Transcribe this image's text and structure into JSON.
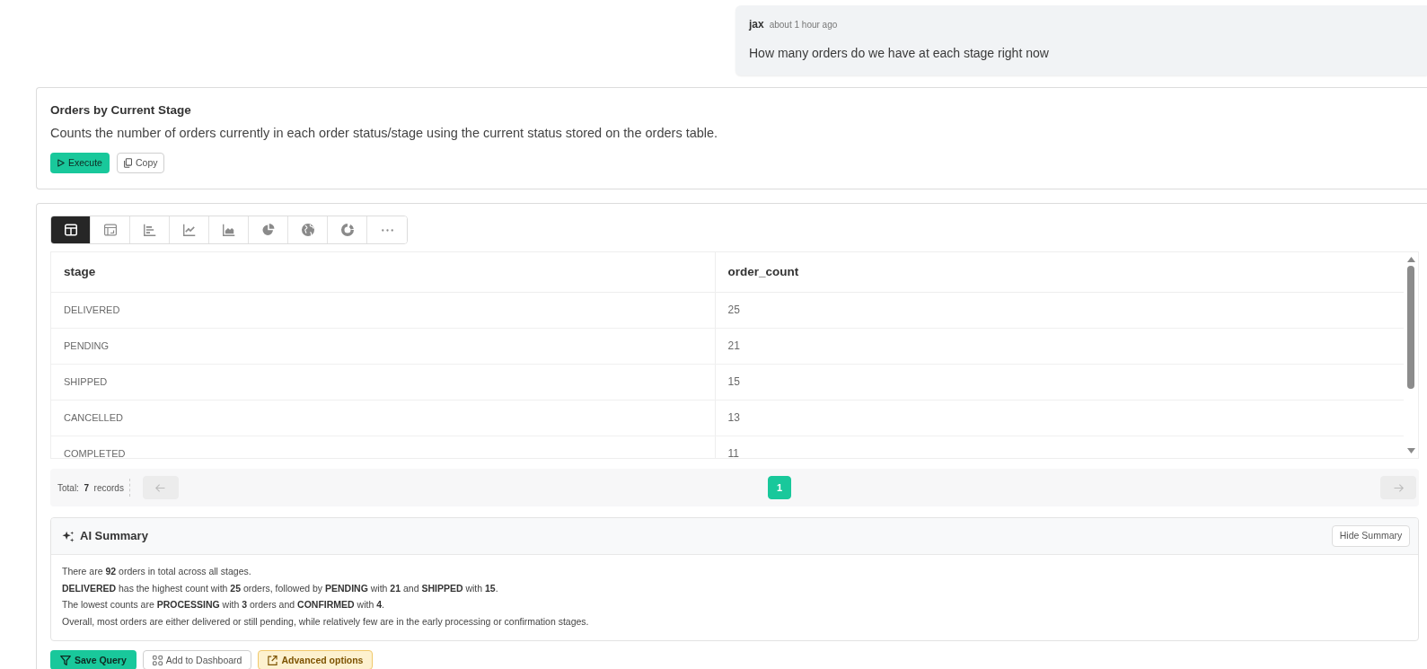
{
  "message": {
    "author": "jax",
    "time": "about 1 hour ago",
    "text": "How many orders do we have at each stage right now"
  },
  "query": {
    "title": "Orders by Current Stage",
    "description": "Counts the number of orders currently in each order status/stage using the current status stored on the orders table.",
    "buttons": [
      {
        "kind": "run",
        "label": "Execute"
      },
      {
        "kind": "copy",
        "label": "Copy"
      }
    ]
  },
  "view_toolbar": [
    {
      "kind": "table",
      "selected": true
    },
    {
      "kind": "pivot",
      "selected": false
    },
    {
      "kind": "bar",
      "selected": false
    },
    {
      "kind": "line",
      "selected": false
    },
    {
      "kind": "area",
      "selected": false
    },
    {
      "kind": "pie",
      "selected": false
    },
    {
      "kind": "map",
      "selected": false
    },
    {
      "kind": "donut",
      "selected": false
    },
    {
      "kind": "more",
      "selected": false
    }
  ],
  "table": {
    "columns": [
      "stage",
      "order_count"
    ],
    "rows": [
      [
        "DELIVERED",
        "25"
      ],
      [
        "PENDING",
        "21"
      ],
      [
        "SHIPPED",
        "15"
      ],
      [
        "CANCELLED",
        "13"
      ],
      [
        "COMPLETED",
        "11"
      ]
    ]
  },
  "pagination": {
    "total": "Total:  **7**  records",
    "prev_disabled": true,
    "next_disabled": true,
    "pages": [
      {
        "label": "1",
        "selected": true
      }
    ]
  },
  "summary": {
    "title": "AI Summary",
    "hide_button": "Hide Summary",
    "lines": [
      "There are **92** orders in total across all stages.",
      "**DELIVERED** has the highest count with **25** orders, followed by **PENDING** with **21** and **SHIPPED** with **15**.",
      "The lowest counts are **PROCESSING** with **3** orders and **CONFIRMED** with **4**.",
      "Overall, most orders are either delivered or still pending, while relatively few are in the early processing or confirmation stages."
    ]
  },
  "actions": [
    {
      "kind": "save",
      "label": "Save Query"
    },
    {
      "kind": "dashboard",
      "label": "Add to Dashboard"
    },
    {
      "kind": "external",
      "label": "Advanced options"
    }
  ]
}
